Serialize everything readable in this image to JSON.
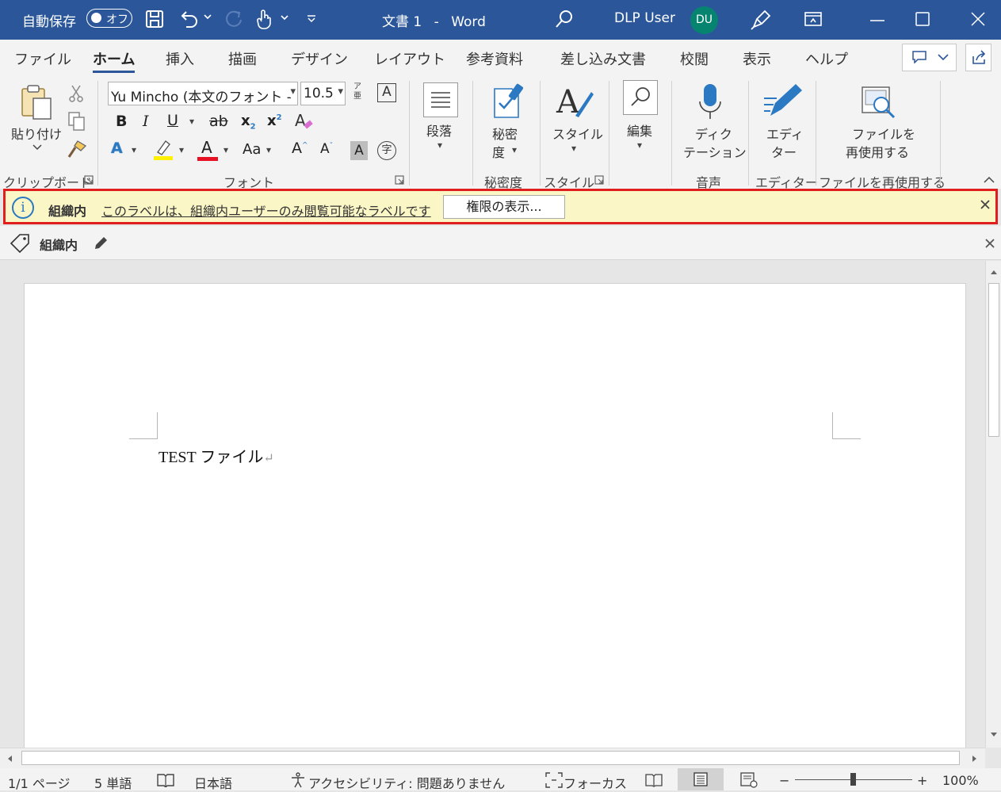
{
  "titlebar": {
    "autosave_label": "自動保存",
    "autosave_state": "オフ",
    "doc_title": "文書 1",
    "title_sep": "-",
    "app_name": "Word",
    "user_name": "DLP User",
    "user_initials": "DU",
    "bg_color": "#2b579a"
  },
  "tabs": [
    "ファイル",
    "ホーム",
    "挿入",
    "描画",
    "デザイン",
    "レイアウト",
    "参考資料",
    "差し込み文書",
    "校閲",
    "表示",
    "ヘルプ"
  ],
  "active_tab": "ホーム",
  "ribbon": {
    "paste_label": "貼り付け",
    "clipboard_group": "クリップボード",
    "font_name": "Yu Mincho (本文のフォント - 日本語)",
    "font_size": "10.5",
    "furigana": "ア亜",
    "bold": "B",
    "italic": "I",
    "underline": "U",
    "strike": "ab",
    "subscript": "x",
    "subscript_mark": "2",
    "superscript": "x",
    "superscript_mark": "2",
    "font_group": "フォント",
    "text_effect": "A",
    "font_color": "A",
    "change_case": "Aa",
    "grow": "A",
    "shrink": "A",
    "char_shading": "A",
    "enclose_char": "字",
    "boxed_char": "A",
    "paragraph_label": "段落",
    "sensitivity_label_1": "秘密",
    "sensitivity_label_2": "度",
    "sensitivity_group": "秘密度",
    "styles_label": "スタイル",
    "styles_group": "スタイル",
    "editing_label": "編集",
    "dictate_label_1": "ディク",
    "dictate_label_2": "テーション",
    "voice_group": "音声",
    "editor_label_1": "エディ",
    "editor_label_2": "ター",
    "editor_group": "エディター",
    "reuse_label_1": "ファイルを",
    "reuse_label_2": "再使用する",
    "reuse_group": "ファイルを再使用する"
  },
  "infobar": {
    "label": "組織内",
    "message": "このラベルは、組織内ユーザーのみ閲覧可能なラベルです",
    "button": "権限の表示...",
    "bg_color": "#fbf6c5",
    "border_color": "#e01e1e"
  },
  "labelbar": {
    "label": "組織内"
  },
  "document": {
    "text": "TEST ファイル",
    "para_mark": "↵"
  },
  "statusbar": {
    "page": "1/1 ページ",
    "words": "5 単語",
    "language": "日本語",
    "accessibility": "アクセシビリティ: 問題ありません",
    "focus": "フォーカス",
    "zoom": "100%",
    "zoom_minus": "−",
    "zoom_plus": "+"
  }
}
